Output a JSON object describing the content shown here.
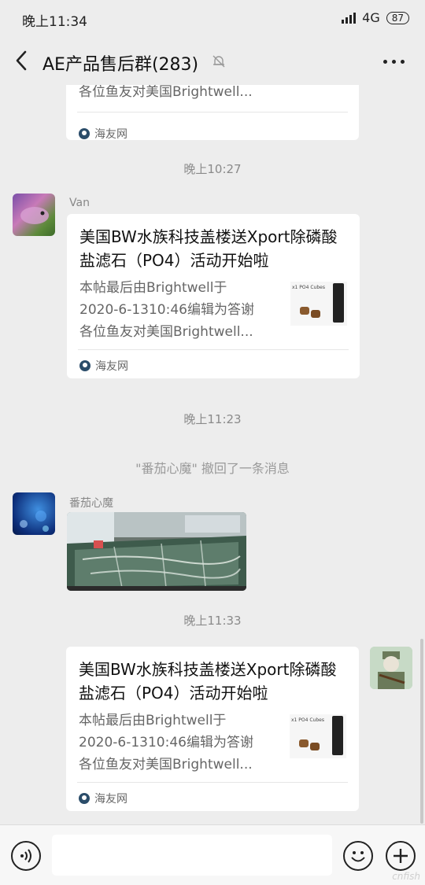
{
  "status_bar": {
    "time": "晚上11:34",
    "network": "4G",
    "battery": "87"
  },
  "header": {
    "title": "AE产品售后群(283)"
  },
  "messages": [
    {
      "type": "link_card_partial",
      "desc_last_line": "各位鱼友对美国Brightwell...",
      "source": "海友网"
    },
    {
      "type": "timestamp",
      "text": "晚上10:27"
    },
    {
      "type": "link_card",
      "sender": "Van",
      "title": "美国BW水族科技盖楼送Xport除磷酸盐滤石（PO4）活动开始啦",
      "desc": [
        "本帖最后由Brightwell于",
        "2020-6-1310:46编辑为答谢",
        "各位鱼友对美国Brightwell..."
      ],
      "source": "海友网"
    },
    {
      "type": "timestamp",
      "text": "晚上11:23"
    },
    {
      "type": "system",
      "text": "\"番茄心魔\" 撤回了一条消息"
    },
    {
      "type": "image",
      "sender": "番茄心魔"
    },
    {
      "type": "timestamp",
      "text": "晚上11:33"
    },
    {
      "type": "link_card",
      "sender": "",
      "title": "美国BW水族科技盖楼送Xport除磷酸盐滤石（PO4）活动开始啦",
      "desc": [
        "本帖最后由Brightwell于",
        "2020-6-1310:46编辑为答谢",
        "各位鱼友对美国Brightwell..."
      ],
      "source": "海友网"
    }
  ],
  "thumb_text": "x1 PO4 Cubes",
  "watermark": "cnfish"
}
